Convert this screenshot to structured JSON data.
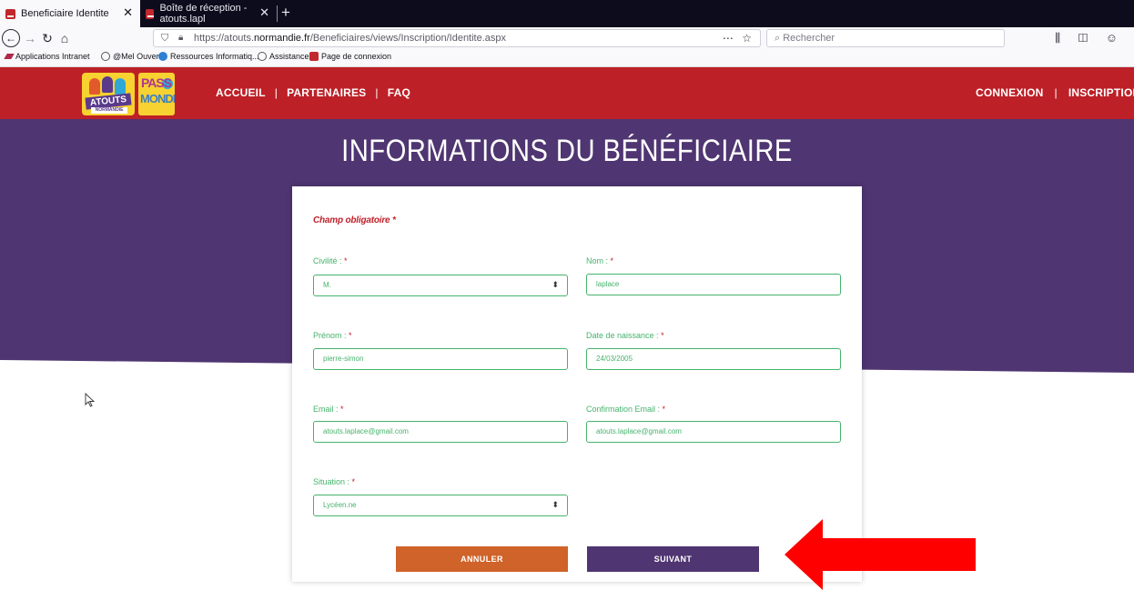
{
  "browser": {
    "tabs": [
      {
        "label": "Beneficiaire Identite"
      },
      {
        "label": "Boîte de réception - atouts.lapl"
      }
    ],
    "url_prefix": "https://atouts.",
    "url_domain": "normandie.fr",
    "url_path": "/Beneficiaires/views/Inscription/Identite.aspx",
    "search_placeholder": "Rechercher",
    "bookmarks": [
      {
        "label": "Applications Intranet",
        "color": "#b0284a"
      },
      {
        "label": "@Mel Ouvert",
        "color": "#555555"
      },
      {
        "label": "Ressources Informatiq...",
        "color": "#2d7fd3"
      },
      {
        "label": "Assistance",
        "color": "#555555"
      },
      {
        "label": "Page de connexion",
        "color": "#c0282d"
      }
    ]
  },
  "site": {
    "logo_atouts": {
      "line1": "ATOUTS",
      "line2": "NORMANDIE"
    },
    "logo_pass": {
      "line1": "PASS",
      "line2": "MONDE"
    },
    "nav_left": [
      "ACCUEIL",
      "PARTENAIRES",
      "FAQ"
    ],
    "nav_right": [
      "CONNEXION",
      "INSCRIPTION"
    ],
    "separator": "|",
    "header_color": "#bd2027",
    "hero_color": "#4f3571"
  },
  "page_title": "INFORMATIONS DU BÉNÉFICIAIRE",
  "form": {
    "required_note": "Champ obligatoire",
    "required_mark": "*",
    "fields": {
      "civilite": {
        "label": "Civilité :",
        "value": "M."
      },
      "nom": {
        "label": "Nom :",
        "value": "laplace"
      },
      "prenom": {
        "label": "Prénom :",
        "value": "pierre-simon"
      },
      "date_naissance": {
        "label": "Date de naissance :",
        "value": "24/03/2005"
      },
      "email": {
        "label": "Email :",
        "value": "atouts.laplace@gmail.com"
      },
      "confirmation_email": {
        "label": "Confirmation Email :",
        "value": "atouts.laplace@gmail.com"
      },
      "situation": {
        "label": "Situation :",
        "value": "Lycéen.ne"
      }
    },
    "buttons": {
      "cancel": "ANNULER",
      "next": "SUIVANT"
    },
    "accent_color": "#45b36b",
    "cancel_color": "#cf6329"
  }
}
